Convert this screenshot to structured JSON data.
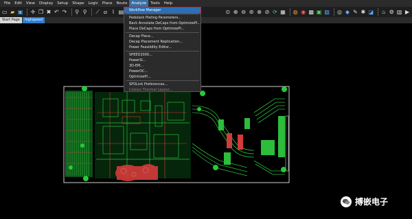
{
  "menu": [
    "File",
    "Edit",
    "View",
    "Display",
    "Setup",
    "Shape",
    "Logic",
    "Place",
    "Route",
    "Analyze",
    "Tools",
    "Help"
  ],
  "menu_active_index": 9,
  "tabs": [
    "Start Page",
    "highspeed"
  ],
  "tab_active_index": 1,
  "analyze_menu": {
    "groups": [
      [
        "Workflow Manager"
      ],
      [
        "Padstack Plating Parameters...",
        "Back Annotate DeCaps from OptimizePI...",
        "Place DeCaps from OptimizePI..."
      ],
      [
        "Decap Place...",
        "Decap Placement Replication...",
        "Power Feasibility Editor..."
      ],
      [
        "SPEED2000...",
        "PowerSI...",
        "3D-EM...",
        "PowerDC...",
        "OptimizePI..."
      ],
      [
        "SPDLink Preferences...",
        "Celsius Thermal Layout..."
      ]
    ],
    "highlighted": "Workflow Manager",
    "disabled": [
      "Celsius Thermal Layout..."
    ]
  },
  "watermark": {
    "text": "搏嵌电子",
    "icon": "wechat-icon"
  },
  "colors": {
    "menu_bg": "#2b2b2b",
    "highlight": "#2d6fb5",
    "highlight_outline": "#e02020",
    "pcb_green": "#1f9a2e",
    "pcb_red": "#d63a3a",
    "board_outline": "#cfcfcf"
  }
}
